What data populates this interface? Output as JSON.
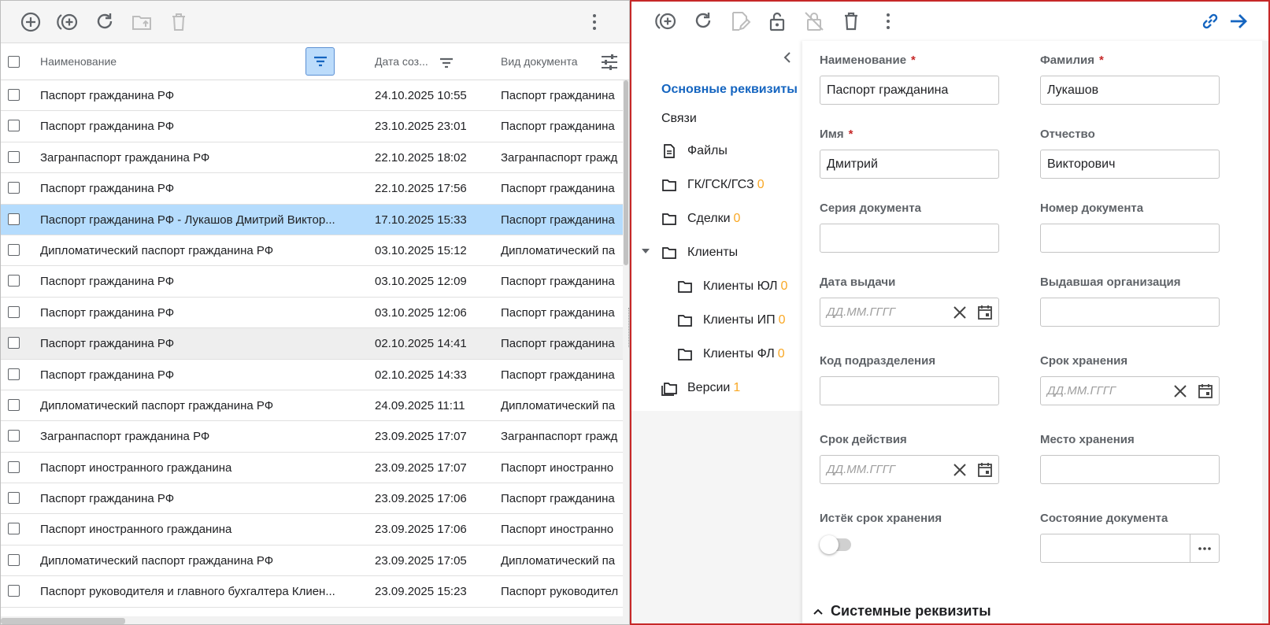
{
  "list": {
    "columns": {
      "name": "Наименование",
      "date": "Дата соз...",
      "type": "Вид документа"
    },
    "rows": [
      {
        "name": "Паспорт гражданина РФ",
        "date": "24.10.2025 10:55",
        "type": "Паспорт гражданина"
      },
      {
        "name": "Паспорт гражданина РФ",
        "date": "23.10.2025 23:01",
        "type": "Паспорт гражданина"
      },
      {
        "name": "Загранпаспорт гражданина РФ",
        "date": "22.10.2025 18:02",
        "type": "Загранпаспорт гражд"
      },
      {
        "name": "Паспорт гражданина РФ",
        "date": "22.10.2025 17:56",
        "type": "Паспорт гражданина"
      },
      {
        "name": "Паспорт гражданина РФ - Лукашов Дмитрий Виктор...",
        "date": "17.10.2025 15:33",
        "type": "Паспорт гражданина"
      },
      {
        "name": "Дипломатический паспорт гражданина РФ",
        "date": "03.10.2025 15:12",
        "type": "Дипломатический па"
      },
      {
        "name": "Паспорт гражданина РФ",
        "date": "03.10.2025 12:09",
        "type": "Паспорт гражданина"
      },
      {
        "name": "Паспорт гражданина РФ",
        "date": "03.10.2025 12:06",
        "type": "Паспорт гражданина"
      },
      {
        "name": "Паспорт гражданина РФ",
        "date": "02.10.2025 14:41",
        "type": "Паспорт гражданина"
      },
      {
        "name": "Паспорт гражданина РФ",
        "date": "02.10.2025 14:33",
        "type": "Паспорт гражданина"
      },
      {
        "name": "Дипломатический паспорт гражданина РФ",
        "date": "24.09.2025 11:11",
        "type": "Дипломатический па"
      },
      {
        "name": "Загранпаспорт гражданина РФ",
        "date": "23.09.2025 17:07",
        "type": "Загранпаспорт гражд"
      },
      {
        "name": "Паспорт иностранного гражданина",
        "date": "23.09.2025 17:07",
        "type": "Паспорт иностранно"
      },
      {
        "name": "Паспорт гражданина РФ",
        "date": "23.09.2025 17:06",
        "type": "Паспорт гражданина"
      },
      {
        "name": "Паспорт иностранного гражданина",
        "date": "23.09.2025 17:06",
        "type": "Паспорт иностранно"
      },
      {
        "name": "Дипломатический паспорт гражданина РФ",
        "date": "23.09.2025 17:05",
        "type": "Дипломатический па"
      },
      {
        "name": "Паспорт руководителя и главного бухгалтера Клиен...",
        "date": "23.09.2025 15:23",
        "type": "Паспорт руководител"
      }
    ]
  },
  "nav": {
    "items": [
      {
        "label": "Основные реквизиты"
      },
      {
        "label": "Связи"
      },
      {
        "label": "Файлы"
      },
      {
        "label": "ГК/ГСК/ГСЗ",
        "count": "0"
      },
      {
        "label": "Сделки",
        "count": "0"
      },
      {
        "label": "Клиенты"
      },
      {
        "label": "Клиенты ЮЛ",
        "count": "0"
      },
      {
        "label": "Клиенты ИП",
        "count": "0"
      },
      {
        "label": "Клиенты ФЛ",
        "count": "0"
      },
      {
        "label": "Версии",
        "count": "1"
      }
    ]
  },
  "form": {
    "name": {
      "label": "Наименование",
      "value": "Паспорт гражданина"
    },
    "lastname": {
      "label": "Фамилия",
      "value": "Лукашов"
    },
    "firstname": {
      "label": "Имя",
      "value": "Дмитрий"
    },
    "middlename": {
      "label": "Отчество",
      "value": "Викторович"
    },
    "series": {
      "label": "Серия документа",
      "value": ""
    },
    "number": {
      "label": "Номер документа",
      "value": ""
    },
    "issue_date": {
      "label": "Дата выдачи",
      "placeholder": "ДД.ММ.ГГГГ"
    },
    "issuer": {
      "label": "Выдавшая организация",
      "value": ""
    },
    "dept_code": {
      "label": "Код подразделения",
      "value": ""
    },
    "storage_period": {
      "label": "Срок хранения",
      "placeholder": "ДД.ММ.ГГГГ"
    },
    "validity": {
      "label": "Срок действия",
      "placeholder": "ДД.ММ.ГГГГ"
    },
    "storage_place": {
      "label": "Место хранения",
      "value": ""
    },
    "expired": {
      "label": "Истёк срок хранения"
    },
    "state": {
      "label": "Состояние документа",
      "value": ""
    },
    "required_mark": "*",
    "system_section": "Системные реквизиты"
  },
  "colors": {
    "accent": "#1565c0",
    "selected_row": "#b5dcfd",
    "count": "#f9a825",
    "required": "#c62828",
    "frame": "#c62828"
  }
}
